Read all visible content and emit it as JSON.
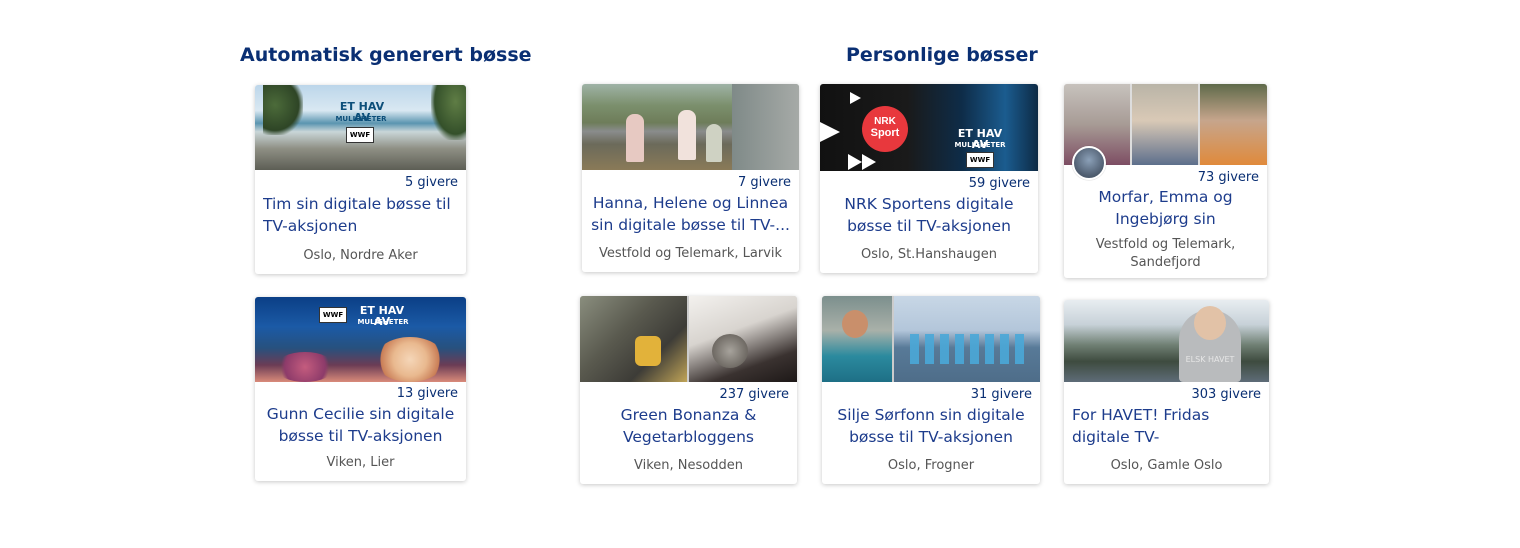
{
  "sections": {
    "auto_title": "Automatisk generert bøsse",
    "personal_title": "Personlige bøsser"
  },
  "cards": [
    {
      "givers": "5 givere",
      "title": "Tim sin digitale bøsse til TV-aksjonen",
      "location": "Oslo, Nordre Aker"
    },
    {
      "givers": "13 givere",
      "title": "Gunn Cecilie sin digitale bøsse til TV-aksjonen",
      "location": "Viken, Lier"
    },
    {
      "givers": "7 givere",
      "title": "Hanna, Helene og Linnea sin digitale bøsse til TV-...",
      "location": "Vestfold og Telemark, Larvik"
    },
    {
      "givers": "59 givere",
      "title": "NRK Sportens digitale bøsse til TV-aksjonen",
      "location": "Oslo, St.Hanshaugen"
    },
    {
      "givers": "73 givere",
      "title": "Morfar, Emma og Ingebjørg sin digitale...",
      "location": "Vestfold og Telemark, Sandefjord"
    },
    {
      "givers": "237 givere",
      "title": "Green Bonanza & Vegetarbloggens digitale..",
      "location": "Viken, Nesodden"
    },
    {
      "givers": "31 givere",
      "title": "Silje Sørfonn sin digitale bøsse til TV-aksjonen",
      "location": "Oslo, Frogner"
    },
    {
      "givers": "303 givere",
      "title": "For HAVET! Fridas digitale TV-aksjonsbøsse.",
      "location": "Oslo, Gamle Oslo"
    }
  ],
  "image_text": {
    "campaign": "ET HAV AV",
    "campaign_sub": "MULIGHETER",
    "wwf": "WWF",
    "nrk": "NRK",
    "sport": "Sport",
    "shirt": "ELSK HAVET"
  },
  "colors": {
    "accent": "#0a2f73",
    "title": "#1d3c8c",
    "location": "#555555"
  }
}
